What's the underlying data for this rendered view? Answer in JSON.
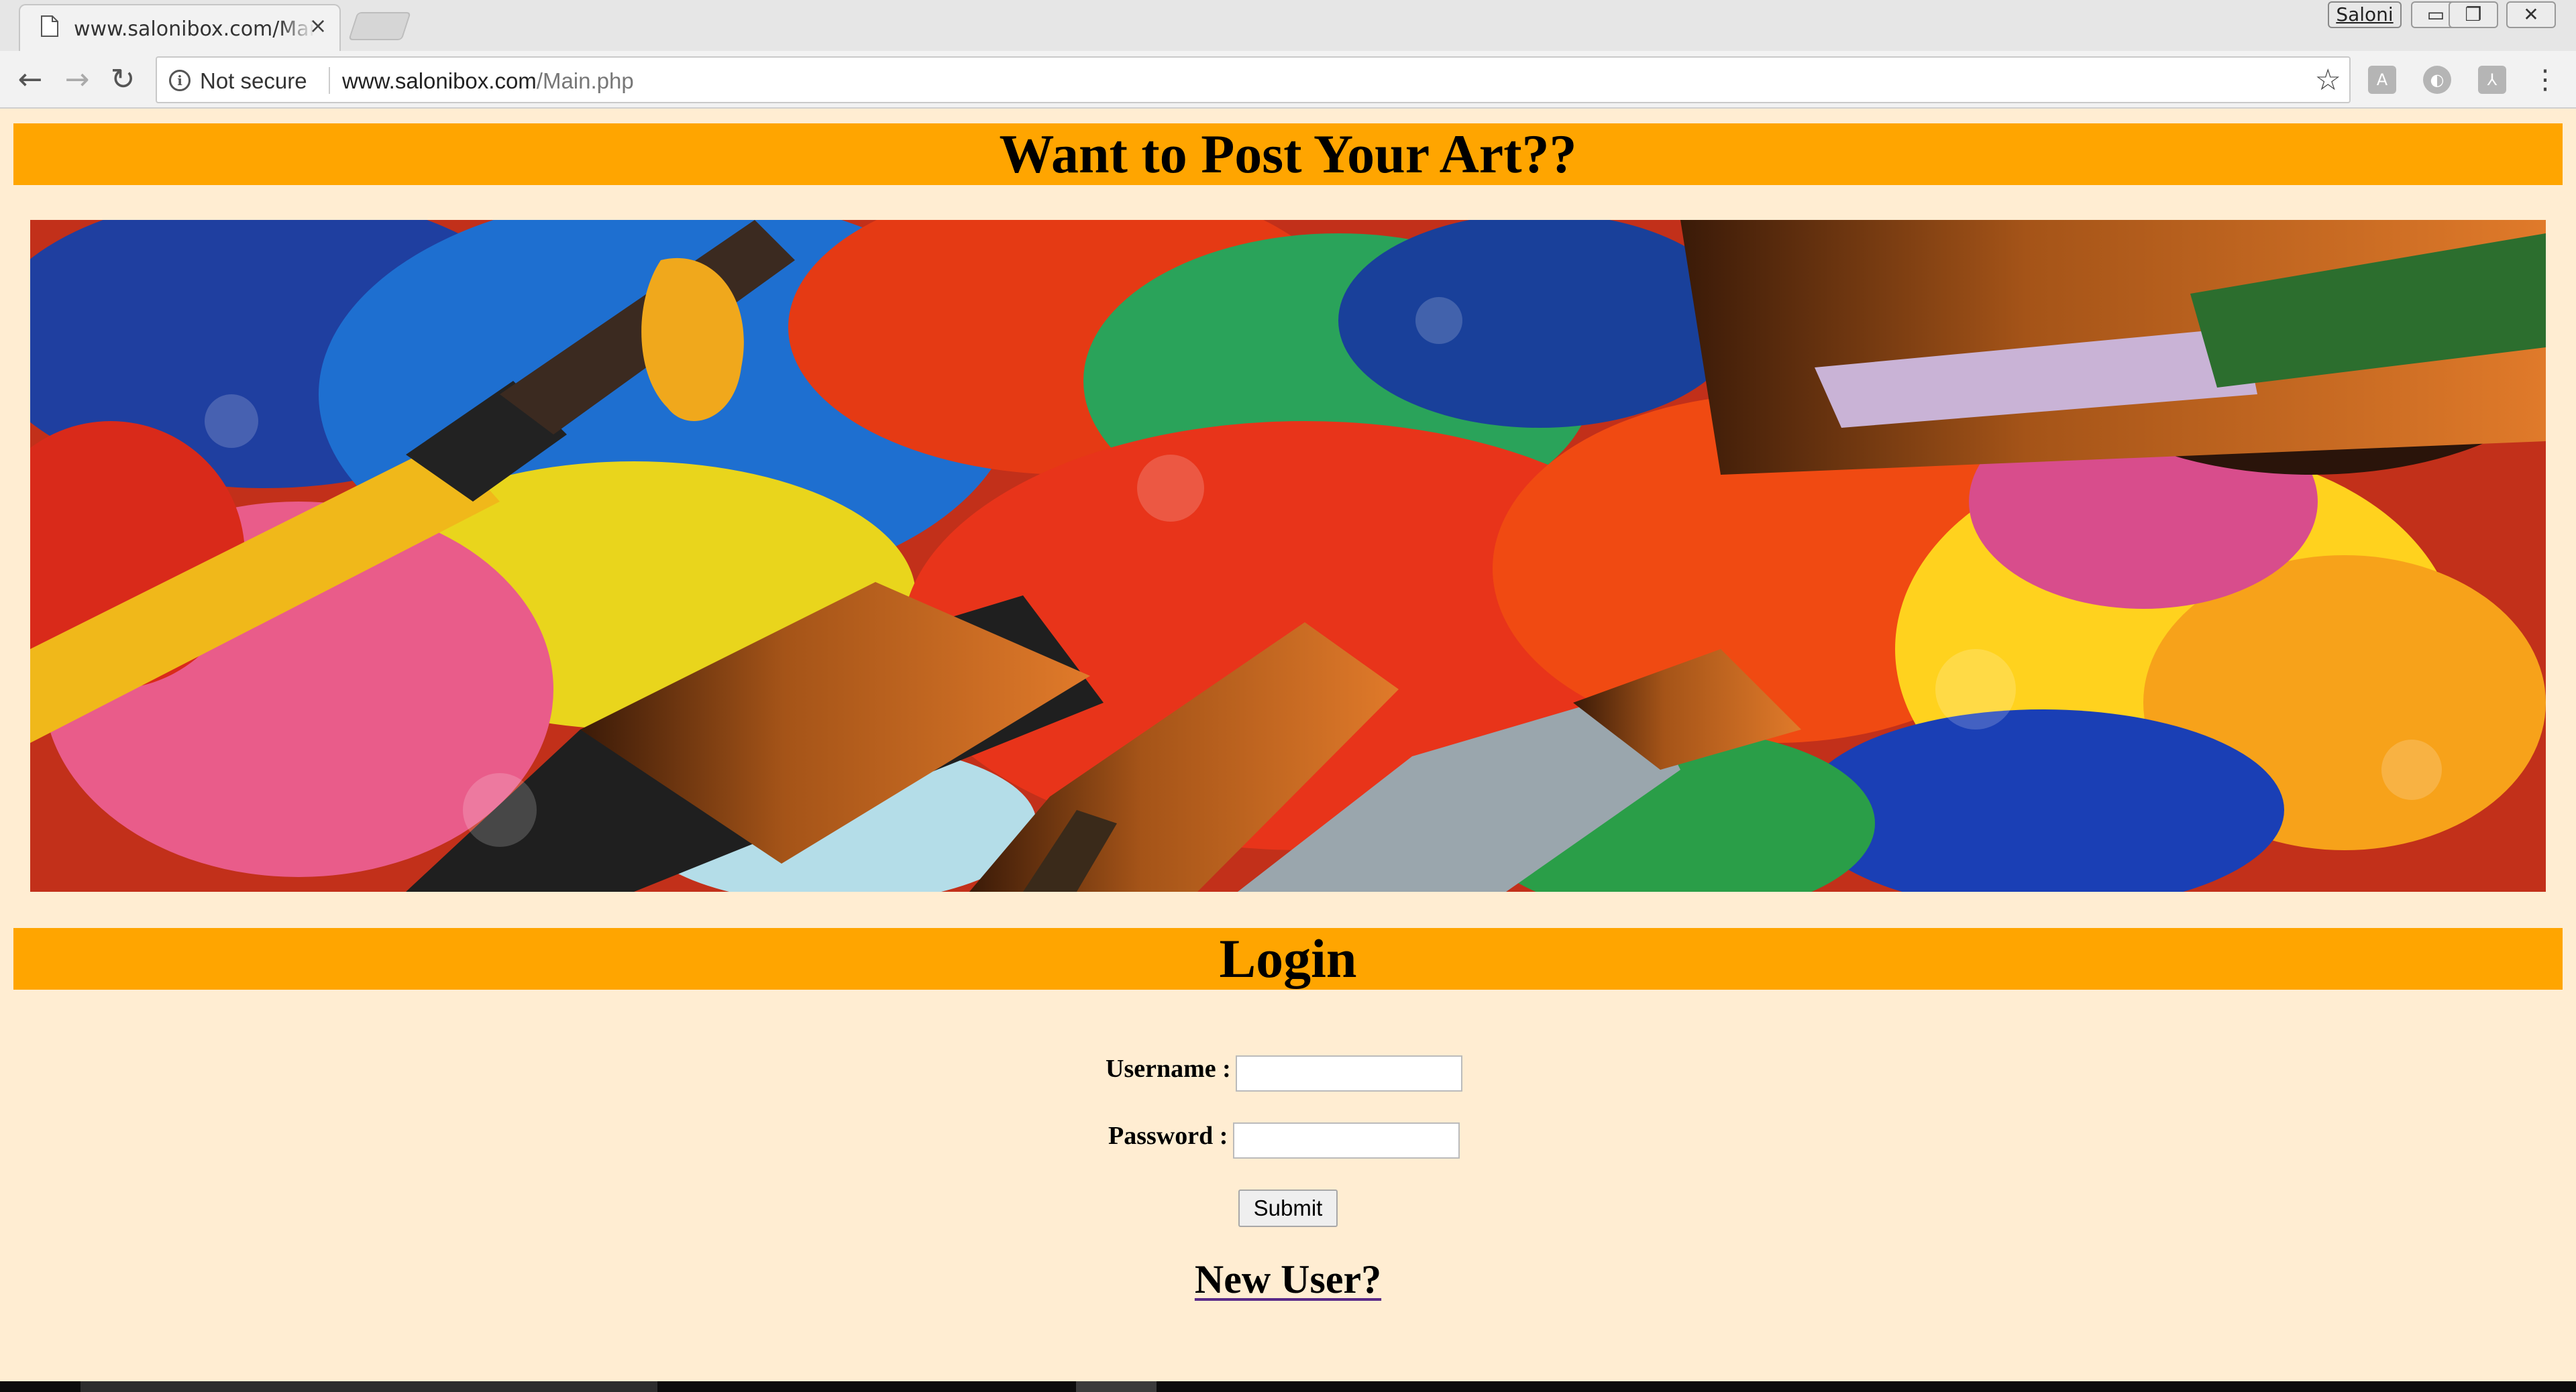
{
  "browser": {
    "tab": {
      "title": "www.salonibox.com/Main.php",
      "close_glyph": "×",
      "icon": "page-icon"
    },
    "profile_name": "Saloni",
    "window_buttons": {
      "minimize": "▭",
      "restore": "❐",
      "close": "✕"
    },
    "nav": {
      "back": "←",
      "forward": "→",
      "reload": "↻"
    },
    "omnibox": {
      "security_label": "Not secure",
      "url_domain": "www.salonibox.com",
      "url_path": "/Main.php",
      "star_glyph": "☆"
    },
    "extensions": [
      "extension-a-icon",
      "extension-b-icon",
      "pdf-extension-icon"
    ],
    "menu_glyph": "⋮"
  },
  "page": {
    "header_title": "Want to Post Your Art??",
    "hero_image": "paint-brushes-on-palette",
    "login_title": "Login",
    "form": {
      "username_label": "Username :",
      "username_value": "",
      "password_label": "Password :",
      "password_value": "",
      "submit_label": "Submit"
    },
    "new_user_link": "New User?"
  },
  "colors": {
    "page_background": "#ffedd2",
    "banner": "#ffa500",
    "link_underline": "#5a2a88"
  }
}
